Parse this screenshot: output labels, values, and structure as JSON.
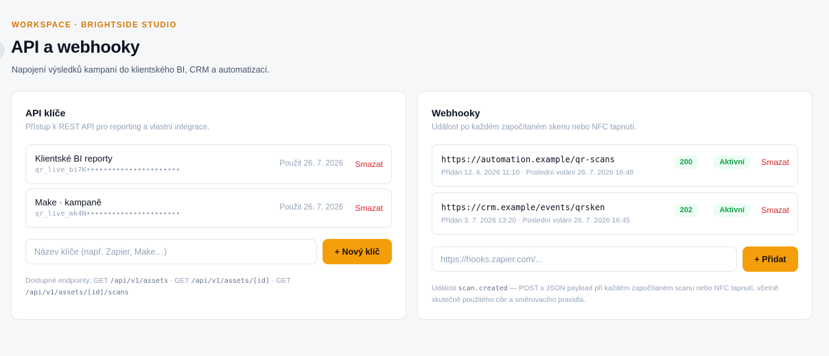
{
  "header": {
    "eyebrow": "WORKSPACE · BRIGHTSIDE STUDIO",
    "title": "API a webhooky",
    "subtitle": "Napojení výsledků kampaní do klientského BI, CRM a automatizací."
  },
  "api_keys": {
    "title": "API klíče",
    "description": "Přístup k REST API pro reporting a vlastní integrace.",
    "items": [
      {
        "name": "Klientské BI reporty",
        "key": "qr_live_bi7K••••••••••••••••••••••",
        "used": "Použit 26. 7. 2026",
        "delete_label": "Smazat"
      },
      {
        "name": "Make · kampaně",
        "key": "qr_live_mk4N••••••••••••••••••••••",
        "used": "Použit 26. 7. 2026",
        "delete_label": "Smazat"
      }
    ],
    "input_placeholder": "Název klíče (např. Zapier, Make…)",
    "add_button": "+ Nový klíč",
    "endpoints_label": "Dostupné endpointy:",
    "endpoints": [
      {
        "method": "GET",
        "path": "/api/v1/assets"
      },
      {
        "method": "GET",
        "path": "/api/v1/assets/[id]"
      },
      {
        "method": "GET",
        "path": "/api/v1/assets/[id]/scans"
      }
    ],
    "separator": "·"
  },
  "webhooks": {
    "title": "Webhooky",
    "description": "Událost po každém započítaném skenu nebo NFC tapnutí.",
    "items": [
      {
        "url": "https://automation.example/qr-scans",
        "meta": "Přidán 12. 6. 2026 11:10 · Poslední volání 26. 7. 2026 16:48",
        "code": "200",
        "status": "Aktivní",
        "delete_label": "Smazat"
      },
      {
        "url": "https://crm.example/events/qrsken",
        "meta": "Přidán 3. 7. 2026 13:20 · Poslední volání 26. 7. 2026 16:45",
        "code": "202",
        "status": "Aktivní",
        "delete_label": "Smazat"
      }
    ],
    "input_placeholder": "https://hooks.zapier.com/...",
    "add_button": "+ Přidat",
    "footnote_prefix": "Událost",
    "footnote_event": "scan.created",
    "footnote_text": "— POST s JSON payload při každém započítaném scanu nebo NFC tapnutí, včetně skutečně použitého cíle a směrovacího pravidla."
  },
  "colors": {
    "accent": "#f59e0b",
    "eyebrow": "#d97706",
    "danger": "#dc2626",
    "success": "#16a34a"
  }
}
